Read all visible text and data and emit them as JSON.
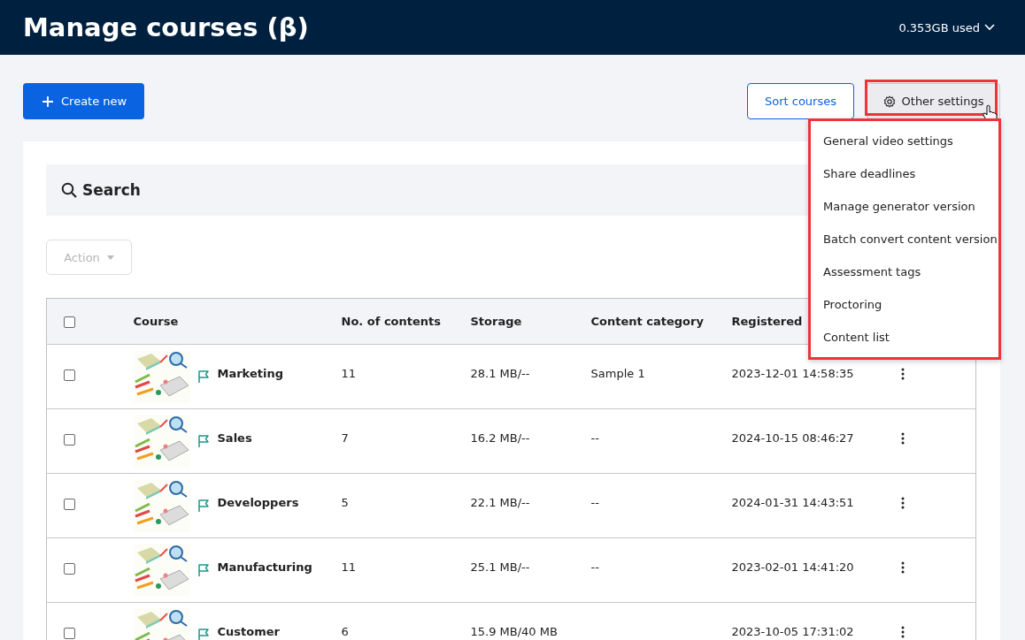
{
  "header": {
    "title": "Manage courses (β)",
    "storage": "0.353GB used"
  },
  "toolbar": {
    "create_button": "Create new",
    "sort_button": "Sort courses",
    "settings_button": "Other settings"
  },
  "settings_menu": {
    "highlighted": true,
    "items": [
      {
        "label": "General video settings"
      },
      {
        "label": "Share deadlines"
      },
      {
        "label": "Manage generator version"
      },
      {
        "label": "Batch convert content version"
      },
      {
        "label": "Assessment tags"
      },
      {
        "label": "Proctoring"
      },
      {
        "label": "Content list"
      }
    ]
  },
  "search": {
    "label": "Search"
  },
  "action_button": {
    "label": "Action",
    "disabled": true
  },
  "table": {
    "columns": [
      "Course",
      "No. of contents",
      "Storage",
      "Content category",
      "Registered"
    ],
    "header_checked": false,
    "rows": [
      {
        "checked": false,
        "course": "Marketing",
        "contents": "11",
        "storage": "28.1 MB/--",
        "category": "Sample 1",
        "registered": "2023-12-01 14:58:35"
      },
      {
        "checked": false,
        "course": "Sales",
        "contents": "7",
        "storage": "16.2 MB/--",
        "category": "--",
        "registered": "2024-10-15 08:46:27"
      },
      {
        "checked": false,
        "course": "Developpers",
        "contents": "5",
        "storage": "22.1 MB/--",
        "category": "--",
        "registered": "2024-01-31 14:43:51"
      },
      {
        "checked": false,
        "course": "Manufacturing",
        "contents": "11",
        "storage": "25.1 MB/--",
        "category": "--",
        "registered": "2023-02-01 14:41:20"
      },
      {
        "checked": false,
        "course": "Customer",
        "contents": "6",
        "storage": "15.9 MB/40 MB",
        "category": "",
        "registered": "2023-10-05 17:31:02"
      }
    ]
  }
}
